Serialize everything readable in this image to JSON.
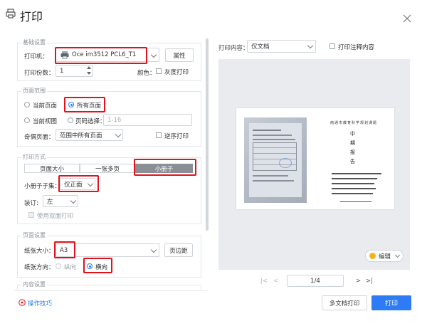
{
  "dialog": {
    "title": "打印"
  },
  "basic": {
    "legend": "基础设置",
    "printer_label": "打印机：",
    "printer_value": "Oce im3512 PCL6_T1",
    "properties_button": "属性",
    "copies_label": "打印份数：",
    "copies_value": "1",
    "color_label": "颜色：",
    "grayscale_label": "灰度打印"
  },
  "page_range": {
    "legend": "页面范围",
    "current_page": "当前页面",
    "all_pages": "所有页面",
    "current_view": "当前视图",
    "page_select": "页码选择：",
    "page_select_placeholder": "1-16",
    "odd_even_label": "奇偶页面：",
    "odd_even_value": "范围中所有页面",
    "reverse_label": "逆序打印"
  },
  "print_mode": {
    "legend": "打印方式",
    "tabs": [
      "页面大小",
      "一张多页",
      "小册子"
    ],
    "booklet_subset_label": "小册子子集：",
    "booklet_subset_value": "仅正面",
    "binding_label": "装订:",
    "binding_value": "左",
    "duplex_label": "使用双面打印"
  },
  "page_setup": {
    "legend": "页面设置",
    "paper_size_label": "纸张大小：",
    "paper_size_value": "A3",
    "margins_button": "页边距",
    "orientation_label": "纸张方向：",
    "portrait": "纵向",
    "landscape": "横向"
  },
  "content": {
    "legend": "内容设置"
  },
  "preview": {
    "content_label": "打印内容：",
    "content_value": "仅文档",
    "annotations_label": "打印注释内容",
    "edit_button": "编辑",
    "page_indicator": "1/4",
    "doc_title": "南通市教育科学规划课题",
    "doc_heading": [
      "中",
      "期",
      "报",
      "告"
    ]
  },
  "footer": {
    "tips_link": "操作技巧",
    "multi_doc_button": "多文档打印",
    "print_button": "打印"
  },
  "colors": {
    "accent": "#2d7cf6",
    "highlight": "#e0121b"
  }
}
